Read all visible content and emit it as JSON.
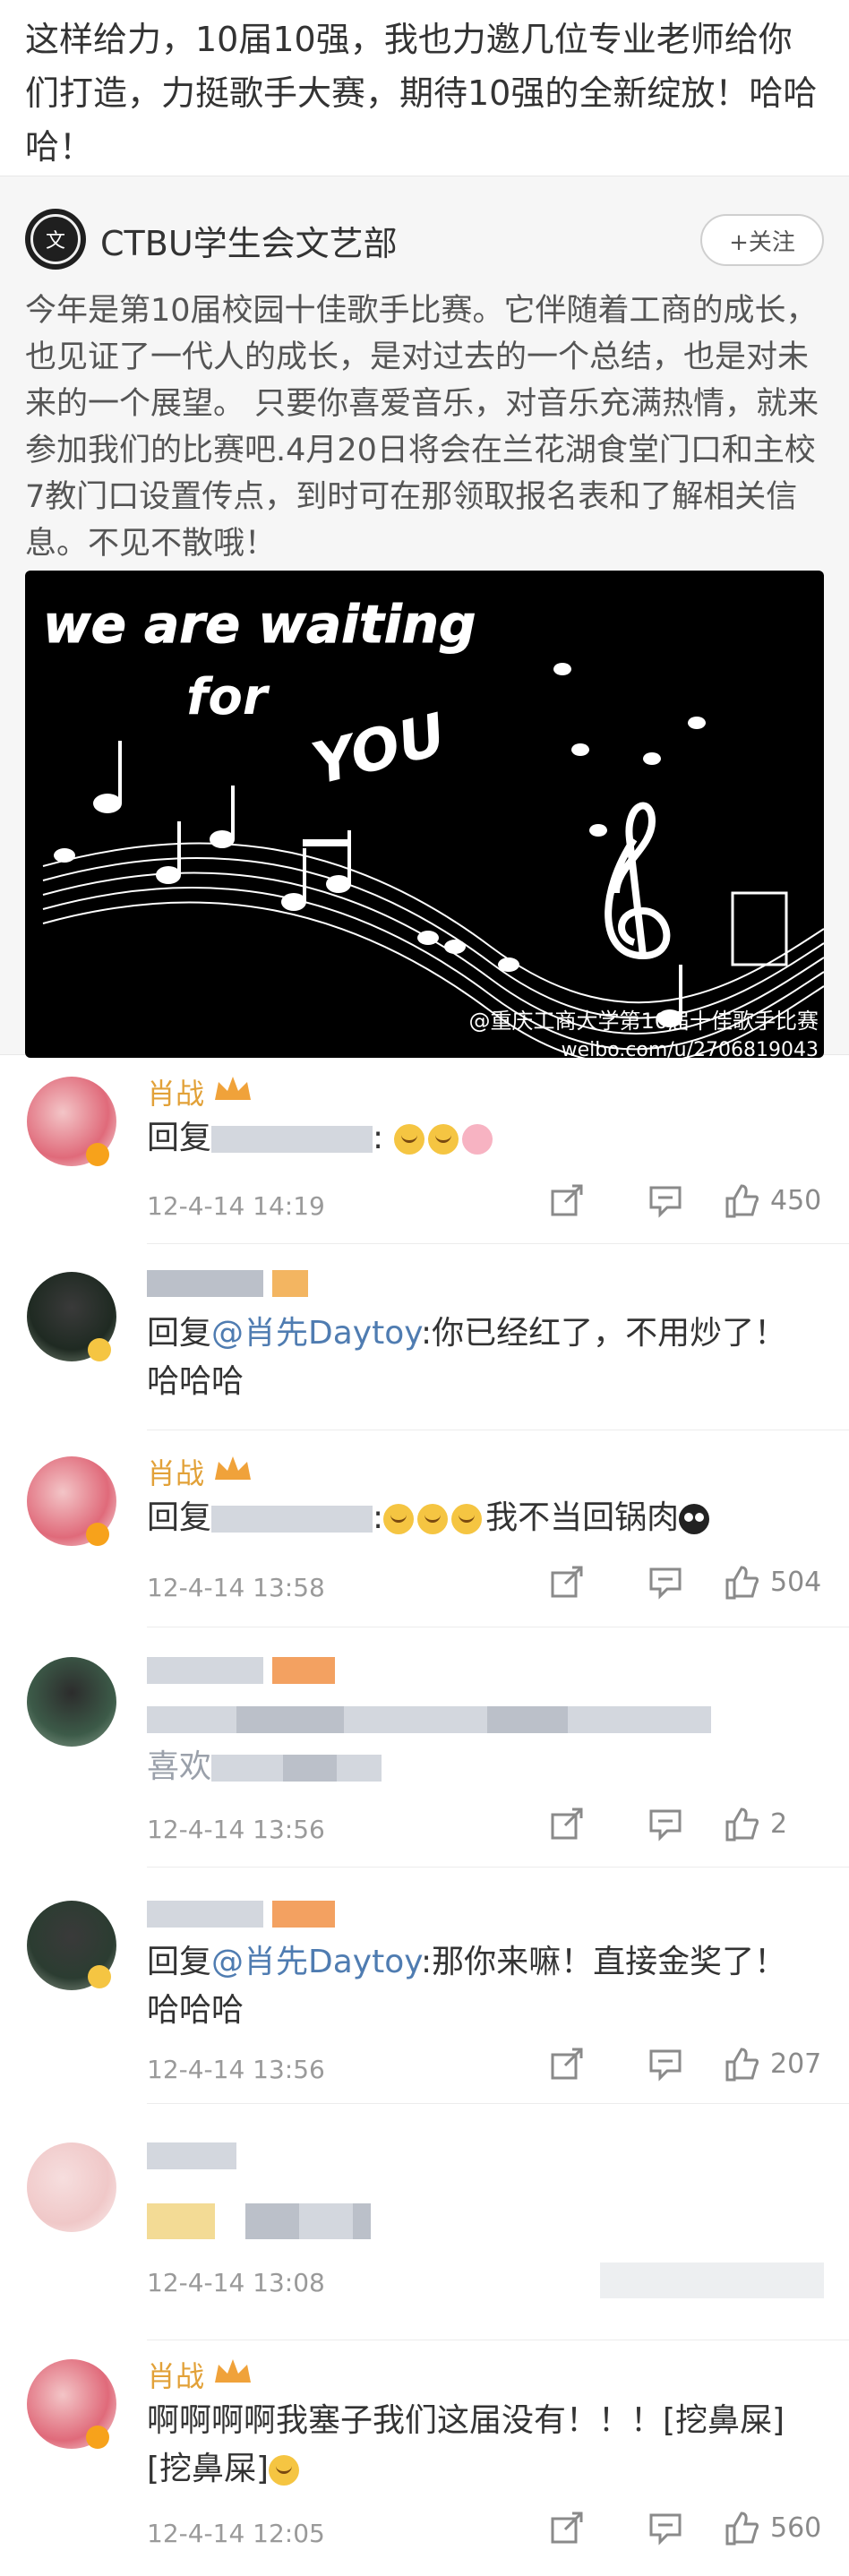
{
  "post": {
    "text": "这样给力，10届10强，我也力邀几位专业老师给你们打造，力挺歌手大赛，期待10强的全新绽放！哈哈哈！"
  },
  "repost": {
    "author": "CTBU学生会文艺部",
    "follow_label": "+关注",
    "body": "今年是第10届校园十佳歌手比赛。它伴随着工商的成长，也见证了一代人的成长，是对过去的一个总结，也是对未来的一个展望。 只要你喜爱音乐，对音乐充满热情，就来参加我们的比赛吧.4月20日将会在兰花湖食堂门口和主校7教门口设置传点，到时可在那领取报名表和了解相关信息。不见不散哦！",
    "image": {
      "line1": "we are waiting",
      "line2": "for",
      "line3": "YOU",
      "watermark": "@重庆工商大学第10届十佳歌手比赛",
      "watermark_url": "weibo.com/u/2706819043"
    }
  },
  "comments": [
    {
      "name": "肖战",
      "reply_prefix": "回复",
      "text_after": ":",
      "time": "12-4-14 14:19",
      "likes": "450"
    },
    {
      "name": "",
      "reply_prefix": "回复",
      "mention": "@肖先Daytoy",
      "text": ":你已经红了，不用炒了！哈哈哈",
      "time": "",
      "likes": ""
    },
    {
      "name": "肖战",
      "reply_prefix": "回复",
      "text": "我不当回锅肉",
      "time": "12-4-14 13:58",
      "likes": "504"
    },
    {
      "name": "",
      "text": "喜欢",
      "time": "12-4-14 13:56",
      "likes": "2"
    },
    {
      "name": "",
      "reply_prefix": "回复",
      "mention": "@肖先Daytoy",
      "text": ":那你来嘛！直接金奖了！哈哈哈",
      "time": "12-4-14 13:56",
      "likes": "207"
    },
    {
      "name": "",
      "text": "",
      "time": "12-4-14 13:08",
      "likes": ""
    },
    {
      "name": "肖战",
      "text": "啊啊啊啊我塞子我们这届没有！！！[挖鼻屎][挖鼻屎]",
      "time": "12-4-14 12:05",
      "likes": "560"
    }
  ],
  "colors": {
    "name_gold": "#e2a138",
    "mention_blue": "#4f7cb1",
    "time_gray": "#9a9a9a"
  },
  "icons": [
    "share-icon",
    "comment-icon",
    "like-icon",
    "crown-icon",
    "verified-icon"
  ]
}
